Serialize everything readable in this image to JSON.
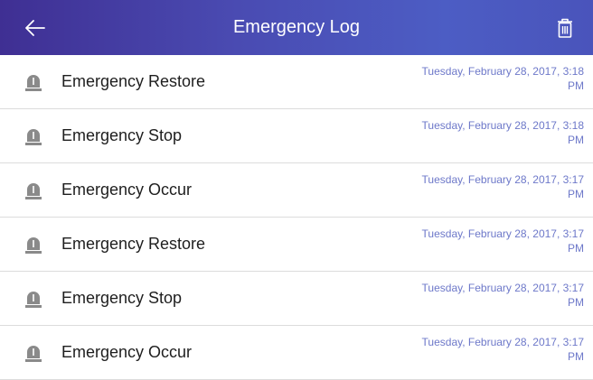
{
  "appbar": {
    "title": "Emergency Log",
    "back_icon": "arrow-left-icon",
    "delete_icon": "trash-icon",
    "gradient": [
      "#3f2f93",
      "#4c5dc4"
    ]
  },
  "log": {
    "icon": "alarm-light-icon",
    "items": [
      {
        "event": "Emergency Restore",
        "time": "Tuesday, February 28, 2017, 3:18 PM"
      },
      {
        "event": "Emergency Stop",
        "time": "Tuesday, February 28, 2017, 3:18 PM"
      },
      {
        "event": "Emergency Occur",
        "time": "Tuesday, February 28, 2017, 3:17 PM"
      },
      {
        "event": "Emergency Restore",
        "time": "Tuesday, February 28, 2017, 3:17 PM"
      },
      {
        "event": "Emergency Stop",
        "time": "Tuesday, February 28, 2017, 3:17 PM"
      },
      {
        "event": "Emergency Occur",
        "time": "Tuesday, February 28, 2017, 3:17 PM"
      }
    ]
  },
  "colors": {
    "timestamp": "#6d78c9",
    "alarm_icon": "#8a8a8a"
  }
}
